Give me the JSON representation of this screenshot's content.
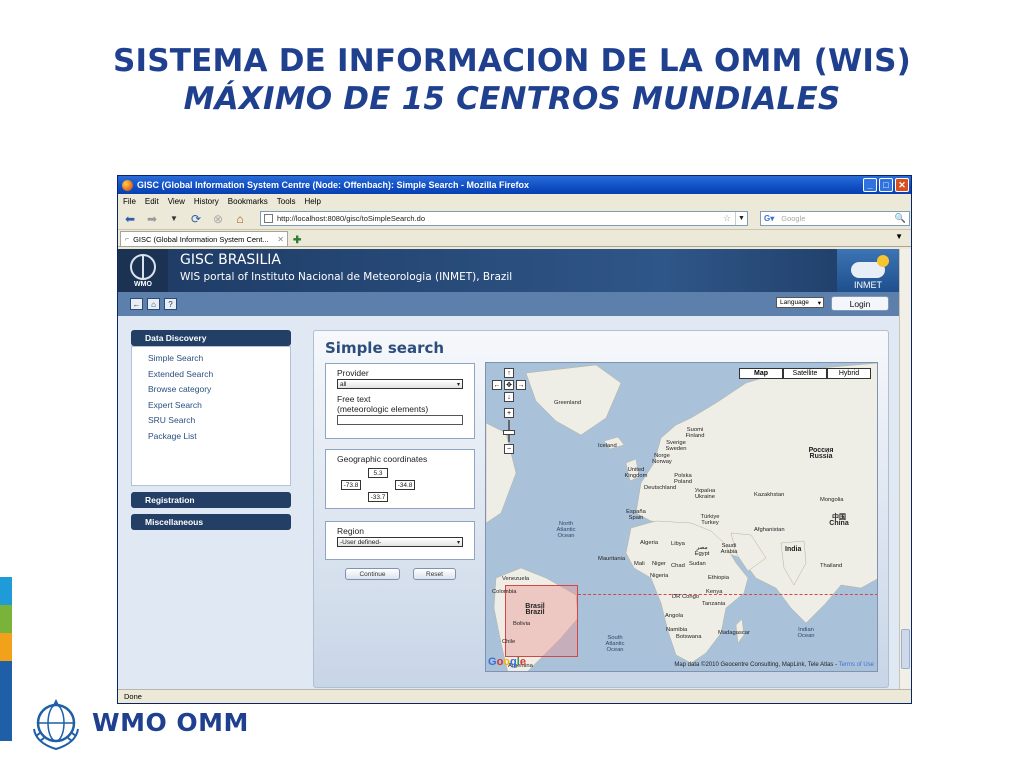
{
  "slide": {
    "title_line1": "SISTEMA DE INFORMACION DE LA OMM (WIS)",
    "title_line2": "MÁXIMO DE 15 CENTROS MUNDIALES",
    "footer_brand": "WMO OMM",
    "side_bar_colors": [
      "#1f9bd7",
      "#79b33a",
      "#f2a21a",
      "#1f5fa8",
      "#1f5fa8",
      "#1f5fa8",
      "#1f5fa8"
    ]
  },
  "browser": {
    "window_title": "GISC (Global Information System Centre (Node: Offenbach): Simple Search - Mozilla Firefox",
    "menu": [
      "File",
      "Edit",
      "View",
      "History",
      "Bookmarks",
      "Tools",
      "Help"
    ],
    "url": "http://localhost:8080/gisc/toSimpleSearch.do",
    "search_placeholder": "Google",
    "tab_label": "GISC (Global Information System Cent...",
    "status": "Done"
  },
  "site": {
    "name": "GISC BRASILIA",
    "subtitle": "WIS portal of Instituto Nacional de Meteorologia (INMET), Brazil",
    "wmo_badge": "WMO",
    "inmet_label": "INMET",
    "language_select": "Language",
    "login_label": "Login"
  },
  "sidebar": {
    "data_discovery": "Data Discovery",
    "links": [
      "Simple Search",
      "Extended Search",
      "Browse category",
      "Expert Search",
      "SRU Search",
      "Package List"
    ],
    "registration": "Registration",
    "miscellaneous": "Miscellaneous"
  },
  "search": {
    "title": "Simple search",
    "provider_label": "Provider",
    "provider_value": "all",
    "free_text_label": "Free text",
    "free_text_hint": "(meteorologic elements)",
    "geo_label": "Geographic coordinates",
    "north": "5.3",
    "west": "-73.8",
    "east": "-34.8",
    "south": "-33.7",
    "region_label": "Region",
    "region_value": "-User defined-",
    "continue_label": "Continue",
    "reset_label": "Reset"
  },
  "map": {
    "types": [
      "Map",
      "Satellite",
      "Hybrid"
    ],
    "selected_type": "Map",
    "attribution": "Map data ©2010 Geocentre Consulting, MapLink, Tele Atlas -",
    "terms": "Terms of Use",
    "labels": [
      "Greenland",
      "Suomi Finland",
      "Sverige Sweden",
      "Iceland",
      "Norge Norway",
      "United Kingdom",
      "Polska Poland",
      "Deutschland",
      "Україна Ukraine",
      "España Spain",
      "Türkiye Turkey",
      "Kazakhstan",
      "Mongolia",
      "Россия Russia",
      "Afghanistan",
      "中国 China",
      "India",
      "North Atlantic Ocean",
      "Algeria",
      "Libya",
      "مصر Egypt",
      "Saudi Arabia",
      "Mauritania",
      "Mali",
      "Niger",
      "Chad",
      "Sudan",
      "Ethiopia",
      "Nigeria",
      "Kenya",
      "DR Congo",
      "Tanzania",
      "Angola",
      "Namibia",
      "Botswana",
      "Madagascar",
      "Thailand",
      "Venezuela",
      "Colombia",
      "Brasil Brazil",
      "Bolivia",
      "Chile",
      "South Atlantic Ocean",
      "Indian Ocean",
      "Argentina"
    ]
  },
  "footer_google": "Google"
}
